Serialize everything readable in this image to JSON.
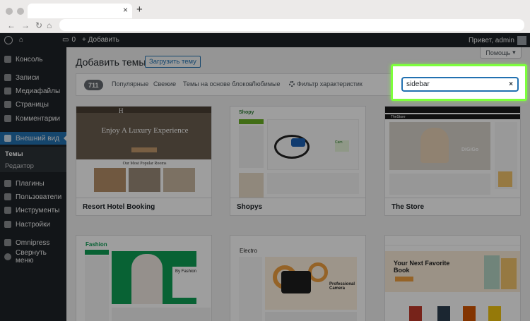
{
  "browser": {
    "new_tab_glyph": "+",
    "tab_close_glyph": "×"
  },
  "admin_bar": {
    "comments_count": "0",
    "new_label": "+ Добавить",
    "greeting": "Привет, admin"
  },
  "sidebar": {
    "items": [
      {
        "label": "Консоль",
        "icon": "dashboard-icon"
      },
      {
        "label": "Записи",
        "icon": "pin-icon"
      },
      {
        "label": "Медиафайлы",
        "icon": "media-icon"
      },
      {
        "label": "Страницы",
        "icon": "page-icon"
      },
      {
        "label": "Комментарии",
        "icon": "comment-icon"
      },
      {
        "label": "Внешний вид",
        "icon": "brush-icon"
      },
      {
        "label": "Плагины",
        "icon": "plugin-icon"
      },
      {
        "label": "Пользователи",
        "icon": "users-icon"
      },
      {
        "label": "Инструменты",
        "icon": "wrench-icon"
      },
      {
        "label": "Настройки",
        "icon": "settings-icon"
      },
      {
        "label": "Omnipress",
        "icon": "omnipress-icon"
      },
      {
        "label": "Свернуть меню",
        "icon": "collapse-icon"
      }
    ],
    "submenu": [
      "Темы",
      "Редактор"
    ]
  },
  "main": {
    "help_label": "Помощь",
    "title": "Добавить темы",
    "upload_label": "Загрузить тему",
    "count": "711",
    "tabs": [
      "Популярные",
      "Свежие",
      "Темы на основе блоков",
      "Любимые"
    ],
    "feature_filter": "Фильтр характеристик",
    "search_value": "sidebar",
    "search_clear": "×"
  },
  "themes": [
    {
      "name": "Resort Hotel Booking",
      "hero": "Enjoy A Luxury Experience",
      "sub": "Our Most Popular Rooms",
      "brand": "H"
    },
    {
      "name": "Shopys",
      "brand": "Shopy"
    },
    {
      "name": "The Store",
      "brand": "TheStore",
      "promo": "DiGiGo"
    },
    {
      "name": "",
      "brand": "Fashion",
      "hero": "By Fashion"
    },
    {
      "name": "",
      "brand": "Electro",
      "hero": "Professional Camera"
    },
    {
      "name": "",
      "hero": "Your Next Favorite Book"
    }
  ],
  "colors": {
    "accent": "#2271b1",
    "admin_dark": "#1d2327",
    "highlight": "#7dff3c"
  }
}
